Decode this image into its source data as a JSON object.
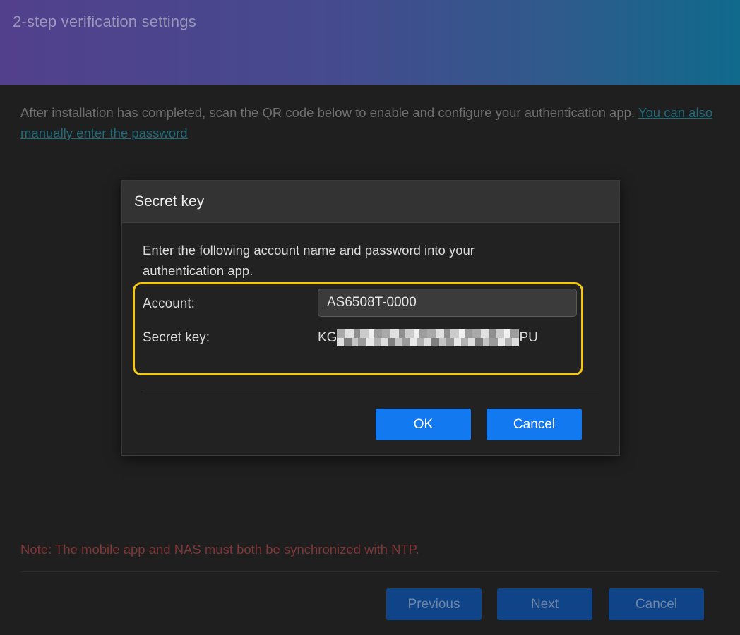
{
  "header": {
    "title": "2-step verification settings"
  },
  "intro": {
    "text": "After installation has completed, scan the QR code below to enable and configure your authentication app. ",
    "link": "You can also manually enter the password"
  },
  "note": "Note: The mobile app and NAS must both be synchronized with NTP.",
  "wizard_buttons": {
    "previous": "Previous",
    "next": "Next",
    "cancel": "Cancel"
  },
  "dialog": {
    "title": "Secret key",
    "description": "Enter the following account name and password into your authentication app.",
    "account_label": "Account:",
    "account_value": "AS6508T-0000",
    "secret_label": "Secret key:",
    "secret_prefix": "KG",
    "secret_suffix": "PU",
    "ok": "OK",
    "cancel": "Cancel"
  },
  "colors": {
    "highlight": "#f2c811",
    "primary_button": "#1279f0",
    "wizard_button": "#0f4588"
  }
}
